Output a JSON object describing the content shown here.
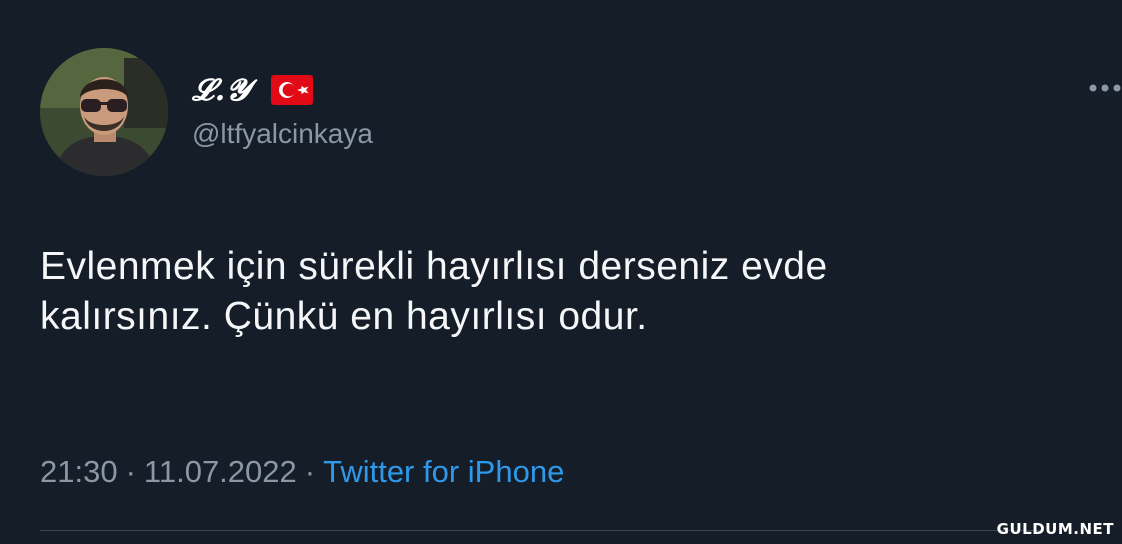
{
  "user": {
    "display_name": "𝓛.𝓨",
    "handle": "@ltfyalcinkaya",
    "flag_icon": "turkey-flag-icon"
  },
  "tweet": {
    "text": "Evlenmek için sürekli hayırlısı derseniz evde\nkalırsınız. Çünkü en hayırlısı odur."
  },
  "meta": {
    "time": "21:30",
    "separator": "·",
    "date": "11.07.2022",
    "source": "Twitter for iPhone"
  },
  "watermark": "GULDUM.NET",
  "colors": {
    "background": "#151d28",
    "text": "#f4f6f8",
    "muted": "#8a97a4",
    "link": "#2f98e8"
  }
}
